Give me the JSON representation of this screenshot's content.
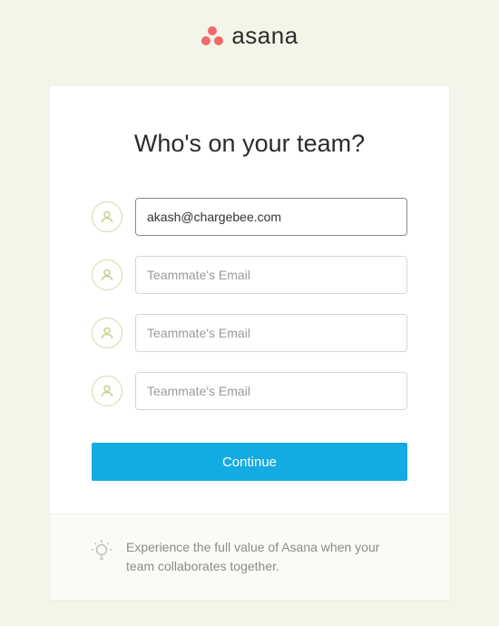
{
  "brand": {
    "name": "asana",
    "logo_color": "#f06a6a"
  },
  "form": {
    "title": "Who's on your team?",
    "emails": [
      {
        "value": "akash@chargebee.com",
        "placeholder": "Teammate's Email"
      },
      {
        "value": "",
        "placeholder": "Teammate's Email"
      },
      {
        "value": "",
        "placeholder": "Teammate's Email"
      },
      {
        "value": "",
        "placeholder": "Teammate's Email"
      }
    ],
    "continue_label": "Continue"
  },
  "footer": {
    "tip": "Experience the full value of Asana when your team collaborates together."
  }
}
